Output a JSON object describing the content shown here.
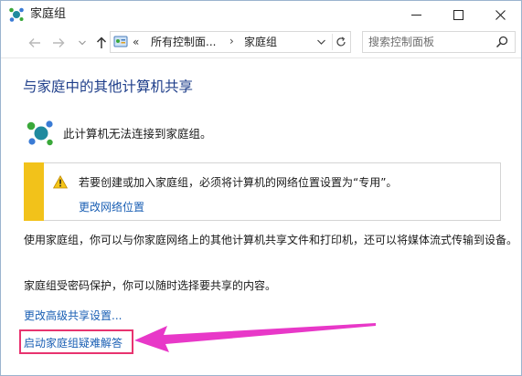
{
  "window": {
    "title": "家庭组",
    "buttons": {
      "minimize_icon": "minimize-icon",
      "maximize_icon": "maximize-icon",
      "close_icon": "close-icon"
    }
  },
  "address_bar": {
    "chevron": "«",
    "crumbs": [
      "所有控制面...",
      "家庭组"
    ],
    "separator": "›"
  },
  "search": {
    "placeholder": "搜索控制面板"
  },
  "main": {
    "title": "与家庭中的其他计算机共享",
    "status": "此计算机无法连接到家庭组。",
    "warning": {
      "text": "若要创建或加入家庭组，必须将计算机的网络位置设置为“专用”。",
      "link": "更改网络位置"
    },
    "paragraph1": "使用家庭组，你可以与你家庭网络上的其他计算机共享文件和打印机，还可以将媒体流式传输到设备。",
    "paragraph2": "家庭组受密码保护，你可以随时选择要共享的内容。",
    "link_advanced": "更改高级共享设置...",
    "link_troubleshoot": "启动家庭组疑难解答"
  },
  "colors": {
    "title_blue": "#1e3e8a",
    "link_blue": "#1a5fb4",
    "warning_bar": "#f2c21a",
    "annotation_pink": "#e8336f"
  }
}
